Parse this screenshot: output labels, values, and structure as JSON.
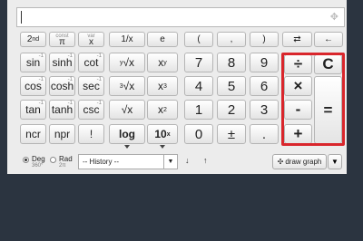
{
  "display": {
    "value": "",
    "move_icon": "move-icon"
  },
  "row0": {
    "nd": "2",
    "nd_sup": "nd",
    "pi": "π",
    "pi_top": "const",
    "x": "x",
    "x_top": "var",
    "one_over_x": "1/x",
    "e": "e",
    "lparen": "(",
    "comma": ",",
    "rparen": ")",
    "swap": "⇄",
    "back": "←"
  },
  "row1": {
    "sin": "sin",
    "sinh": "sinh",
    "cot": "cot",
    "yroot_pre": "y",
    "yroot": "√x",
    "xy": "x",
    "xy_sup": "y",
    "d7": "7",
    "d8": "8",
    "d9": "9",
    "divide": "÷",
    "clear": "C"
  },
  "row2": {
    "cos": "cos",
    "cosh": "cosh",
    "sec": "sec",
    "croot_pre": "3",
    "croot": "√x",
    "x3": "x",
    "x3_sup": "3",
    "d4": "4",
    "d5": "5",
    "d6": "6",
    "times": "×",
    "equals": "="
  },
  "row3": {
    "tan": "tan",
    "tanh": "tanh",
    "csc": "csc",
    "sqrt": "√x",
    "x2": "x",
    "x2_sup": "2",
    "d1": "1",
    "d2": "2",
    "d3": "3",
    "minus": "-"
  },
  "row4": {
    "ncr": "ncr",
    "npr": "npr",
    "fact": "!",
    "log": "log",
    "ten": "10",
    "ten_sup": "x",
    "d0": "0",
    "pm": "±",
    "dot": ".",
    "plus": "+"
  },
  "inv_mark": "-1",
  "angle": {
    "deg": "Deg",
    "deg_sub": "360°",
    "rad": "Rad",
    "rad_sub": "2π",
    "selected": "Deg"
  },
  "history": {
    "label": "-- History --"
  },
  "nav": {
    "down": "↓",
    "up": "↑"
  },
  "graph": {
    "label": "draw graph",
    "icon": "✣"
  },
  "colors": {
    "highlight": "#d9262c",
    "background": "#2b3440",
    "panel": "#ececec"
  }
}
